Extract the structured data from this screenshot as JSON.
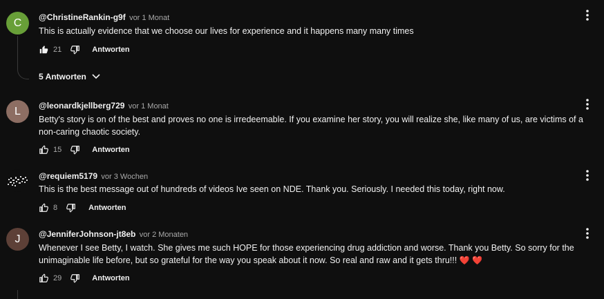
{
  "comments": [
    {
      "avatar_letter": "C",
      "avatar_color": "#689f38",
      "author": "@ChristineRankin-g9f",
      "time": "vor 1 Monat",
      "text": "This is actually evidence that we choose our lives for experience and it happens many many times",
      "likes": "21",
      "reply_label": "Antworten",
      "replies_label": "5 Antworten"
    },
    {
      "avatar_letter": "L",
      "avatar_color": "#8d6e63",
      "author": "@leonardkjellberg729",
      "time": "vor 1 Monat",
      "text": "Betty's story is on of the best and proves no one is irredeemable. If you examine her story, you will realize she, like many of us, are victims of a non-caring chaotic society.",
      "likes": "15",
      "reply_label": "Antworten"
    },
    {
      "avatar_icon": "pixel-art-avatar",
      "author": "@requiem5179",
      "time": "vor 3 Wochen",
      "text": "This is the best message out of hundreds of videos Ive seen on NDE. Thank you. Seriously. I needed this today, right now.",
      "likes": "8",
      "reply_label": "Antworten"
    },
    {
      "avatar_letter": "J",
      "avatar_color": "#5d4037",
      "author": "@JenniferJohnson-jt8eb",
      "time": "vor 2 Monaten",
      "text": "Whenever I see Betty, I watch. She gives me such HOPE for those experiencing drug addiction and worse. Thank you Betty.  So sorry for the unimaginable life before,  but so grateful for the way you speak about it now. So real and raw and it gets thru!!! ",
      "emoji": "❤️ ❤️",
      "likes": "29",
      "reply_label": "Antworten"
    }
  ]
}
